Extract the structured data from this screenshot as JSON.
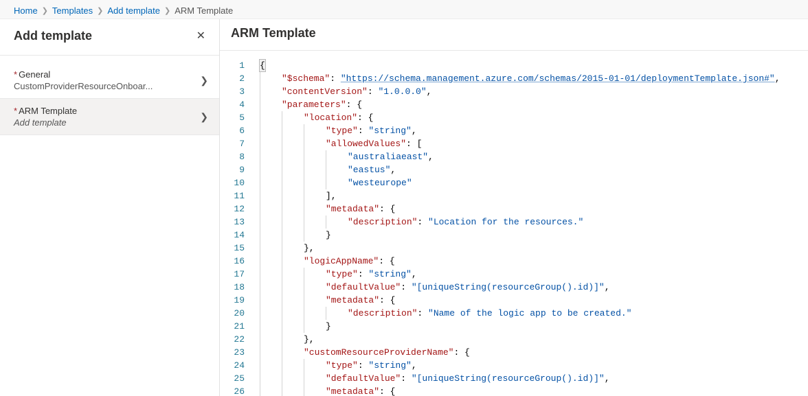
{
  "breadcrumb": {
    "items": [
      "Home",
      "Templates",
      "Add template"
    ],
    "current": "ARM Template"
  },
  "leftPane": {
    "title": "Add template",
    "sections": {
      "general": {
        "label": "General",
        "sub": "CustomProviderResourceOnboar...",
        "required": true
      },
      "arm": {
        "label": "ARM Template",
        "sub": "Add template",
        "required": true
      }
    }
  },
  "rightPane": {
    "title": "ARM Template"
  },
  "code": {
    "lineCount": 26,
    "lines": [
      {
        "i": 0,
        "segs": [
          [
            "p",
            "{",
            "brace"
          ]
        ]
      },
      {
        "i": 1,
        "segs": [
          [
            "k",
            "\"$schema\""
          ],
          [
            "p",
            ": "
          ],
          [
            "lnk",
            "\"https://schema.management.azure.com/schemas/2015-01-01/deploymentTemplate.json#\""
          ],
          [
            "p",
            ","
          ]
        ]
      },
      {
        "i": 1,
        "segs": [
          [
            "k",
            "\"contentVersion\""
          ],
          [
            "p",
            ": "
          ],
          [
            "s",
            "\"1.0.0.0\""
          ],
          [
            "p",
            ","
          ]
        ]
      },
      {
        "i": 1,
        "segs": [
          [
            "k",
            "\"parameters\""
          ],
          [
            "p",
            ": {"
          ]
        ]
      },
      {
        "i": 2,
        "segs": [
          [
            "k",
            "\"location\""
          ],
          [
            "p",
            ": {"
          ]
        ]
      },
      {
        "i": 3,
        "segs": [
          [
            "k",
            "\"type\""
          ],
          [
            "p",
            ": "
          ],
          [
            "s",
            "\"string\""
          ],
          [
            "p",
            ","
          ]
        ]
      },
      {
        "i": 3,
        "segs": [
          [
            "k",
            "\"allowedValues\""
          ],
          [
            "p",
            ": ["
          ]
        ]
      },
      {
        "i": 4,
        "segs": [
          [
            "s",
            "\"australiaeast\""
          ],
          [
            "p",
            ","
          ]
        ]
      },
      {
        "i": 4,
        "segs": [
          [
            "s",
            "\"eastus\""
          ],
          [
            "p",
            ","
          ]
        ]
      },
      {
        "i": 4,
        "segs": [
          [
            "s",
            "\"westeurope\""
          ]
        ]
      },
      {
        "i": 3,
        "segs": [
          [
            "p",
            "],"
          ]
        ]
      },
      {
        "i": 3,
        "segs": [
          [
            "k",
            "\"metadata\""
          ],
          [
            "p",
            ": {"
          ]
        ]
      },
      {
        "i": 4,
        "segs": [
          [
            "k",
            "\"description\""
          ],
          [
            "p",
            ": "
          ],
          [
            "s",
            "\"Location for the resources.\""
          ]
        ]
      },
      {
        "i": 3,
        "segs": [
          [
            "p",
            "}"
          ]
        ]
      },
      {
        "i": 2,
        "segs": [
          [
            "p",
            "},"
          ]
        ]
      },
      {
        "i": 2,
        "segs": [
          [
            "k",
            "\"logicAppName\""
          ],
          [
            "p",
            ": {"
          ]
        ]
      },
      {
        "i": 3,
        "segs": [
          [
            "k",
            "\"type\""
          ],
          [
            "p",
            ": "
          ],
          [
            "s",
            "\"string\""
          ],
          [
            "p",
            ","
          ]
        ]
      },
      {
        "i": 3,
        "segs": [
          [
            "k",
            "\"defaultValue\""
          ],
          [
            "p",
            ": "
          ],
          [
            "s",
            "\"[uniqueString(resourceGroup().id)]\""
          ],
          [
            "p",
            ","
          ]
        ]
      },
      {
        "i": 3,
        "segs": [
          [
            "k",
            "\"metadata\""
          ],
          [
            "p",
            ": {"
          ]
        ]
      },
      {
        "i": 4,
        "segs": [
          [
            "k",
            "\"description\""
          ],
          [
            "p",
            ": "
          ],
          [
            "s",
            "\"Name of the logic app to be created.\""
          ]
        ]
      },
      {
        "i": 3,
        "segs": [
          [
            "p",
            "}"
          ]
        ]
      },
      {
        "i": 2,
        "segs": [
          [
            "p",
            "},"
          ]
        ]
      },
      {
        "i": 2,
        "segs": [
          [
            "k",
            "\"customResourceProviderName\""
          ],
          [
            "p",
            ": {"
          ]
        ]
      },
      {
        "i": 3,
        "segs": [
          [
            "k",
            "\"type\""
          ],
          [
            "p",
            ": "
          ],
          [
            "s",
            "\"string\""
          ],
          [
            "p",
            ","
          ]
        ]
      },
      {
        "i": 3,
        "segs": [
          [
            "k",
            "\"defaultValue\""
          ],
          [
            "p",
            ": "
          ],
          [
            "s",
            "\"[uniqueString(resourceGroup().id)]\""
          ],
          [
            "p",
            ","
          ]
        ]
      },
      {
        "i": 3,
        "segs": [
          [
            "k",
            "\"metadata\""
          ],
          [
            "p",
            ": {"
          ]
        ]
      }
    ]
  }
}
